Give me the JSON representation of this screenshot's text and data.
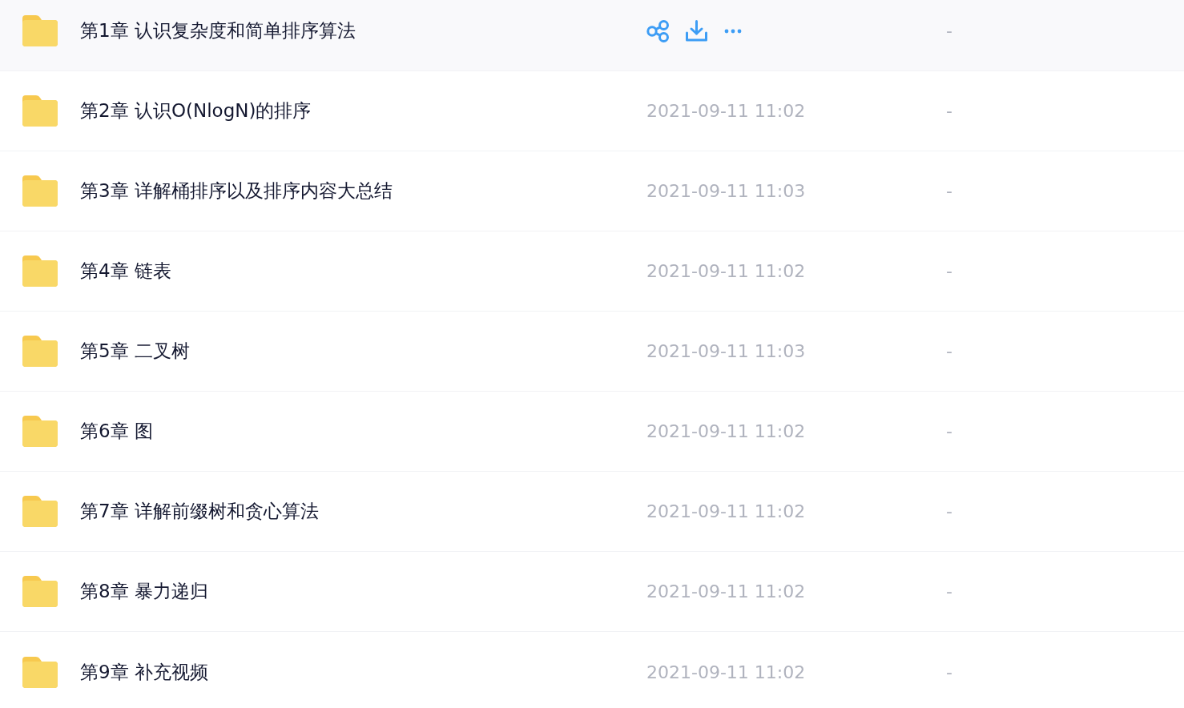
{
  "files": [
    {
      "name": "第1章 认识复杂度和简单排序算法",
      "hovered": true,
      "size": "-"
    },
    {
      "name": "第2章 认识O(NlogN)的排序",
      "hovered": false,
      "modified": "2021-09-11 11:02",
      "size": "-"
    },
    {
      "name": "第3章 详解桶排序以及排序内容大总结",
      "hovered": false,
      "modified": "2021-09-11 11:03",
      "size": "-"
    },
    {
      "name": "第4章 链表",
      "hovered": false,
      "modified": "2021-09-11 11:02",
      "size": "-"
    },
    {
      "name": "第5章 二叉树",
      "hovered": false,
      "modified": "2021-09-11 11:03",
      "size": "-"
    },
    {
      "name": "第6章 图",
      "hovered": false,
      "modified": "2021-09-11 11:02",
      "size": "-"
    },
    {
      "name": "第7章 详解前缀树和贪心算法",
      "hovered": false,
      "modified": "2021-09-11 11:02",
      "size": "-"
    },
    {
      "name": "第8章 暴力递归",
      "hovered": false,
      "modified": "2021-09-11 11:02",
      "size": "-"
    },
    {
      "name": "第9章 补充视频",
      "hovered": false,
      "modified": "2021-09-11 11:02",
      "size": "-"
    }
  ]
}
